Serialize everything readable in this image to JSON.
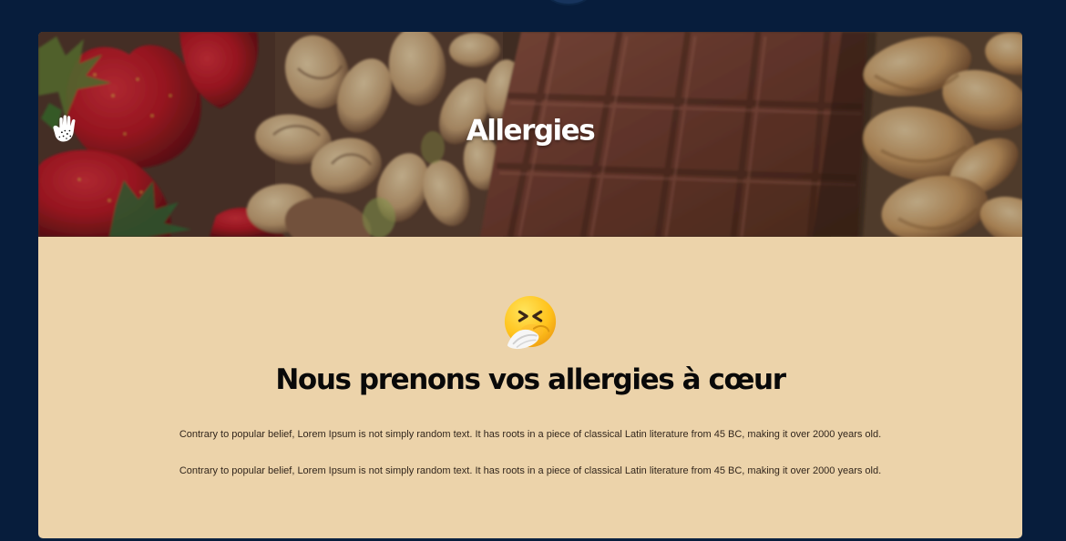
{
  "hero": {
    "title": "Allergies",
    "icon": "hand-allergy-icon",
    "image": "strawberries-pistachios-chocolate-peanuts"
  },
  "main": {
    "icon": "sneezing-face-icon",
    "title": "Nous prenons vos allergies à cœur",
    "paragraphs": [
      "Contrary to popular belief, Lorem Ipsum is not simply random text. It has roots in a piece of classical Latin literature from 45 BC, making it over 2000 years old.",
      "Contrary to popular belief, Lorem Ipsum is not simply random text. It has roots in a piece of classical Latin literature from 45 BC, making it over 2000 years old."
    ]
  },
  "colors": {
    "page_background": "#071d3c",
    "card_background": "#ecd3aa",
    "title_text": "#090909",
    "hero_text": "#ffffff"
  }
}
